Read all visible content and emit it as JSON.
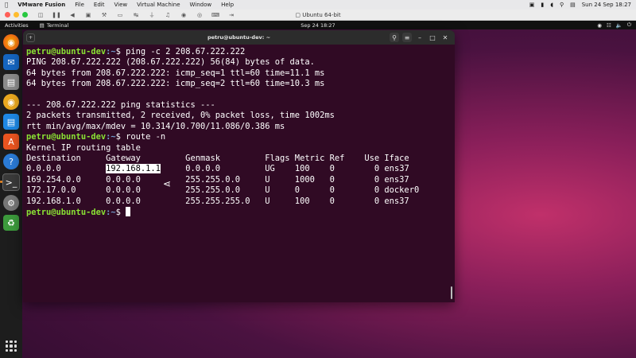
{
  "mac_menubar": {
    "apple_icon": "apple-icon",
    "app_name": "VMware Fusion",
    "menus": [
      "File",
      "Edit",
      "View",
      "Virtual Machine",
      "Window",
      "Help"
    ],
    "datetime": "Sun 24 Sep 18:27"
  },
  "vm_toolbar": {
    "title": "Ubuntu 64-bit"
  },
  "ubuntu_topbar": {
    "activities": "Activities",
    "app_label": "Terminal",
    "clock": "Sep 24  18:27"
  },
  "terminal": {
    "window_title": "petru@ubuntu-dev: ~",
    "prompt_user": "petru@ubuntu-dev",
    "prompt_path": ":~",
    "prompt_symbol": "$ ",
    "lines": {
      "cmd1": "ping -c 2 208.67.222.222",
      "l1": "PING 208.67.222.222 (208.67.222.222) 56(84) bytes of data.",
      "l2": "64 bytes from 208.67.222.222: icmp_seq=1 ttl=60 time=11.1 ms",
      "l3": "64 bytes from 208.67.222.222: icmp_seq=2 ttl=60 time=10.3 ms",
      "l4": "",
      "l5": "--- 208.67.222.222 ping statistics ---",
      "l6": "2 packets transmitted, 2 received, 0% packet loss, time 1002ms",
      "l7": "rtt min/avg/max/mdev = 10.314/10.700/11.086/0.386 ms",
      "cmd2": "route -n",
      "l8": "Kernel IP routing table",
      "header": "Destination     Gateway         Genmask         Flags Metric Ref    Use Iface",
      "r1_dest": "0.0.0.0         ",
      "r1_gw": "192.168.1.1",
      "r1_rest": "     0.0.0.0         UG    100    0        0 ens37",
      "r2": "169.254.0.0     0.0.0.0         255.255.0.0     U     1000   0        0 ens37",
      "r3": "172.17.0.0      0.0.0.0         255.255.0.0     U     0      0        0 docker0",
      "r4": "192.168.1.0     0.0.0.0         255.255.255.0   U     100    0        0 ens37"
    }
  },
  "dock_apps": [
    "firefox-icon",
    "thunderbird-icon",
    "files-icon",
    "rhythmbox-icon",
    "writer-icon",
    "app-center-icon",
    "help-icon",
    "terminal-icon",
    "settings-icon",
    "trash-icon"
  ]
}
